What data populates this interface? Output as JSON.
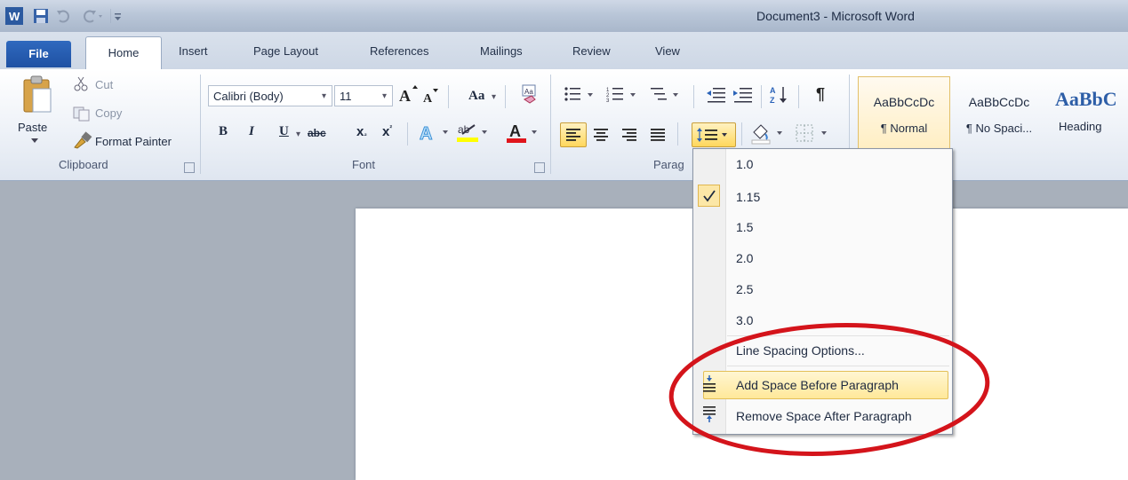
{
  "window": {
    "title": "Document3  -  Microsoft Word"
  },
  "qat": {
    "save_icon": "save-icon",
    "undo_icon": "undo-icon",
    "redo_icon": "redo-icon"
  },
  "tabs": [
    "File",
    "Home",
    "Insert",
    "Page Layout",
    "References",
    "Mailings",
    "Review",
    "View"
  ],
  "clipboard": {
    "paste": "Paste",
    "cut": "Cut",
    "copy": "Copy",
    "format_painter": "Format Painter",
    "label": "Clipboard"
  },
  "font": {
    "name": "Calibri (Body)",
    "size": "11",
    "label": "Font",
    "change_case": "Aa",
    "bold": "B",
    "italic": "I",
    "underline": "U",
    "strikethrough": "abc",
    "subscript": "x",
    "superscript": "x"
  },
  "paragraph": {
    "label": "Parag"
  },
  "styles": [
    {
      "sample": "AaBbCcDc",
      "name": "¶ Normal"
    },
    {
      "sample": "AaBbCcDc",
      "name": "¶ No Spaci..."
    },
    {
      "sample": "AaBbC",
      "name": "Heading"
    }
  ],
  "line_spacing_menu": {
    "values": [
      "1.0",
      "1.15",
      "1.5",
      "2.0",
      "2.5",
      "3.0"
    ],
    "selected": "1.15",
    "options": "Line Spacing Options...",
    "add_before": "Add Space Before Paragraph",
    "remove_after": "Remove Space After Paragraph"
  },
  "colors": {
    "annotation": "#d4141b",
    "file_tab": "#2a5fb3"
  }
}
